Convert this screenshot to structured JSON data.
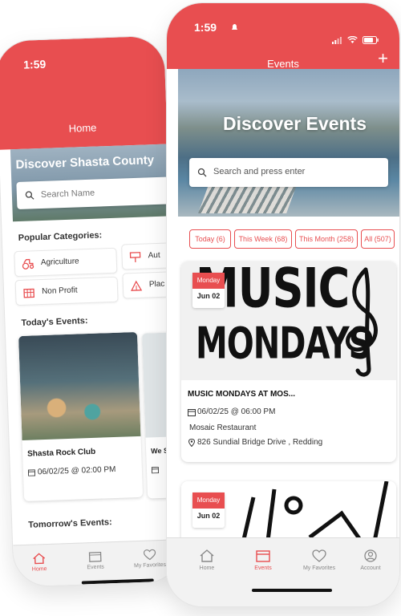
{
  "back_phone": {
    "status_time": "1:59",
    "header_title": "Home",
    "hero_title": "Discover Shasta County",
    "search_placeholder": "Search Name",
    "popular_categories_title": "Popular Categories:",
    "categories": [
      "Agriculture",
      "Aut",
      "Non Profit",
      "Plac"
    ],
    "todays_events_title": "Today's Events:",
    "event": {
      "name": "Shasta Rock Club",
      "datetime": "06/02/25 @ 02:00 PM"
    },
    "event2_name_partial": "We Si",
    "tomorrows_events_title": "Tomorrow's Events:",
    "tabs": [
      "Home",
      "Events",
      "My Favorites"
    ]
  },
  "front_phone": {
    "status_time": "1:59",
    "header_title": "Events",
    "add_label": "+",
    "hero_title": "Discover Events",
    "search_placeholder": "Search and press enter",
    "filter_chips": [
      "Today (6)",
      "This Week (68)",
      "This Month (258)",
      "All (507)"
    ],
    "events": [
      {
        "day": "Monday",
        "date": "Jun 02",
        "image_text": [
          "MUSIC",
          "MONDAYS"
        ],
        "title": "MUSIC MONDAYS AT MOS...",
        "datetime": "06/02/25 @ 06:00 PM",
        "venue": "Mosaic Restaurant",
        "address": "826 Sundial Bridge Drive , Redding"
      },
      {
        "day": "Monday",
        "date": "Jun 02"
      }
    ],
    "tabs": [
      "Home",
      "Events",
      "My Favorites",
      "Account"
    ]
  },
  "colors": {
    "accent": "#e84e50",
    "tabbar": "#f2f2f2"
  }
}
